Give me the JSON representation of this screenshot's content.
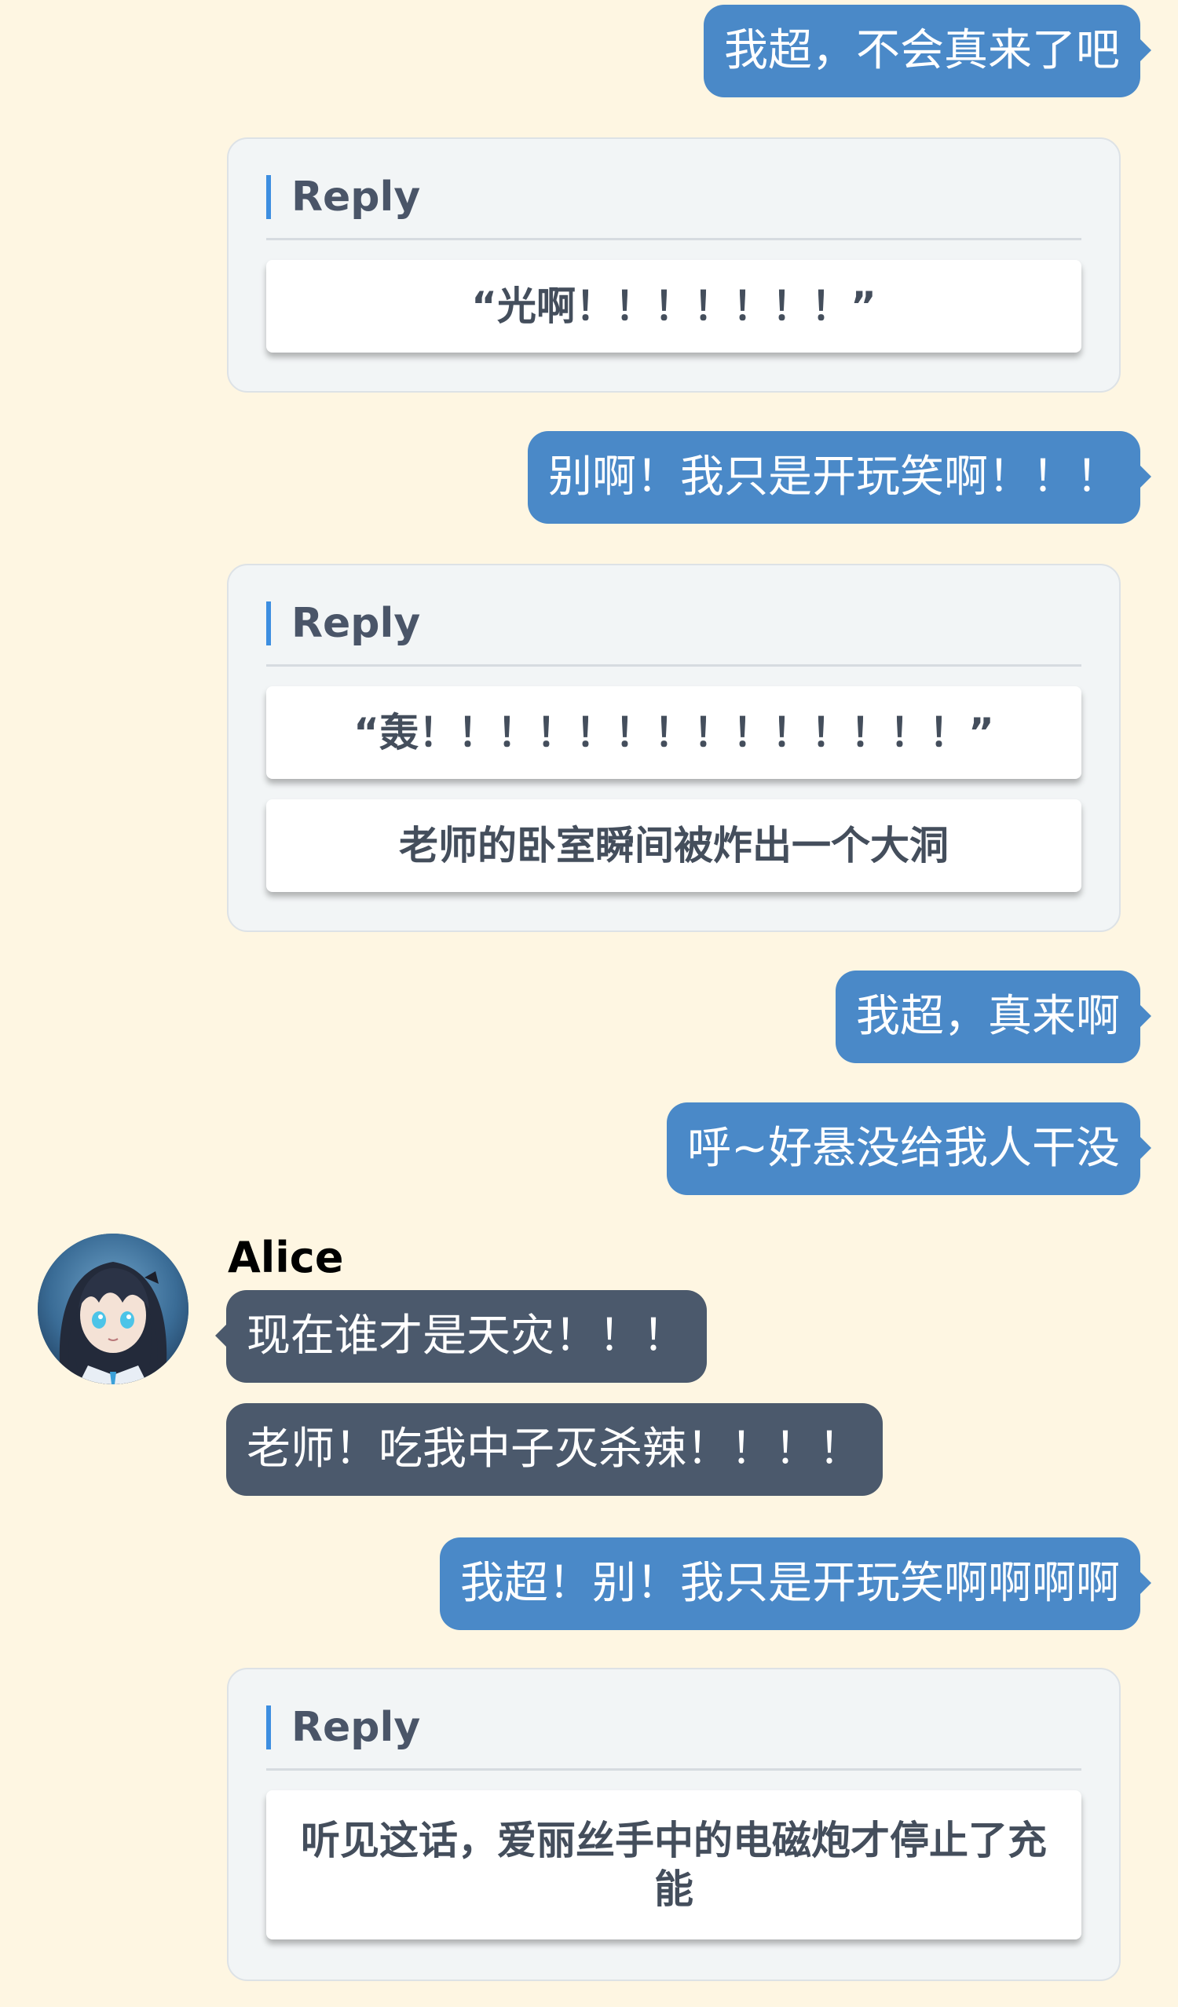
{
  "messages": {
    "m1": "我超，不会真来了吧",
    "m2": "别啊！我只是开玩笑啊！！！",
    "m3": "我超，真来啊",
    "m4": "呼~好悬没给我人干没",
    "m5": "我超！别！我只是开玩笑啊啊啊啊"
  },
  "alice": {
    "name": "Alice",
    "m1": "现在谁才是天灾！！！",
    "m2": "老师！吃我中子灭杀辣！！！！"
  },
  "reply1": {
    "header": "Reply",
    "option1": "“光啊！！！！！！！”"
  },
  "reply2": {
    "header": "Reply",
    "option1": "“轰！！！！！！！！！！！！！！”",
    "option2": "老师的卧室瞬间被炸出一个大洞"
  },
  "reply3": {
    "header": "Reply",
    "option1": "听见这话，爱丽丝手中的电磁炮才停止了充能"
  },
  "colors": {
    "background": "#fef6e2",
    "player_bubble": "#4a89c8",
    "npc_bubble": "#4b596c",
    "reply_accent": "#3d8ee0"
  }
}
